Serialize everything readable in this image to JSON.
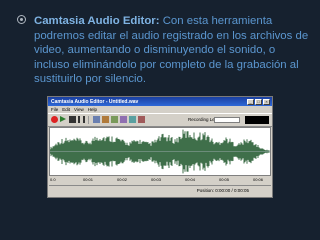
{
  "slide": {
    "bullet": {
      "title": "Camtasia Audio Editor:",
      "text": " Con esta herramienta podremos editar el audio registrado en los archivos de video, aumentando o disminuyendo el sonido, o incluso eliminándolo por completo de la grabación al sustituirlo por silencio."
    }
  },
  "app": {
    "title": "Camtasia Audio Editor - Untitled.wav",
    "menu": [
      "File",
      "Edit",
      "View",
      "Help"
    ],
    "recording_level_label": "Recording Level",
    "timeline_ticks": [
      "0.0",
      "00:01",
      "00:02",
      "00:03",
      "00:04",
      "00:05",
      "00:06"
    ],
    "position_text": "Position: 0:00:00 / 0:00:05",
    "colors": {
      "waveform": "#3f6f4a",
      "titlebar": "#1a3fa0",
      "window": "#d4d0c8"
    },
    "icons": [
      "record-icon",
      "play-icon",
      "stop-icon",
      "pause-icon",
      "close-icon"
    ]
  }
}
